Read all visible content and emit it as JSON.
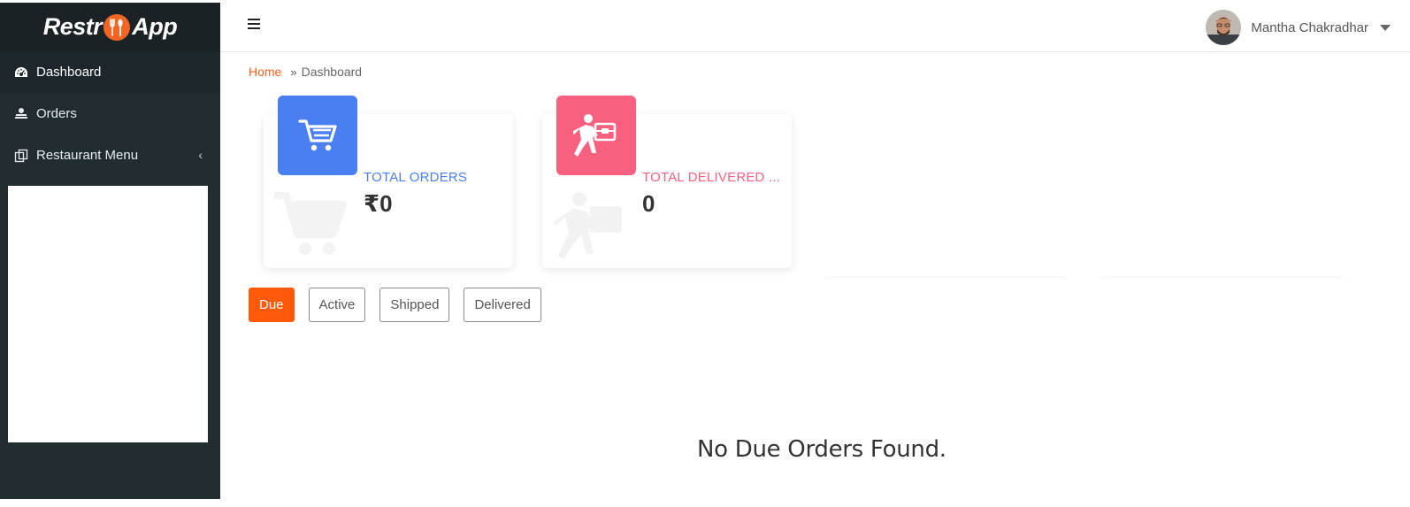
{
  "brand": {
    "name_part1": "Restr",
    "name_part2": "App"
  },
  "sidebar": {
    "items": [
      {
        "label": "Dashboard",
        "icon": "dashboard-icon",
        "active": true
      },
      {
        "label": "Orders",
        "icon": "orders-icon",
        "active": false
      },
      {
        "label": "Restaurant Menu",
        "icon": "menu-icon",
        "active": false,
        "chevron": "‹"
      }
    ]
  },
  "header": {
    "menu_icon": "hamburger-icon",
    "user_name": "Mantha Chakradhar"
  },
  "breadcrumb": {
    "home": "Home",
    "separator": "»",
    "current": "Dashboard"
  },
  "stats": [
    {
      "label": "TOTAL ORDERS",
      "value": "₹0",
      "icon": "cart-icon",
      "color": "#4a7ff2"
    },
    {
      "label": "TOTAL DELIVERED ...",
      "value": "0",
      "icon": "delivery-icon",
      "color": "#f7607f"
    }
  ],
  "tabs": [
    {
      "label": "Due",
      "active": true
    },
    {
      "label": "Active",
      "active": false
    },
    {
      "label": "Shipped",
      "active": false
    },
    {
      "label": "Delivered",
      "active": false
    }
  ],
  "empty_message": "No Due Orders Found.",
  "colors": {
    "accent": "#fe5a0a",
    "sidebar_bg": "#222d32",
    "brand_bg": "#1a2226"
  }
}
